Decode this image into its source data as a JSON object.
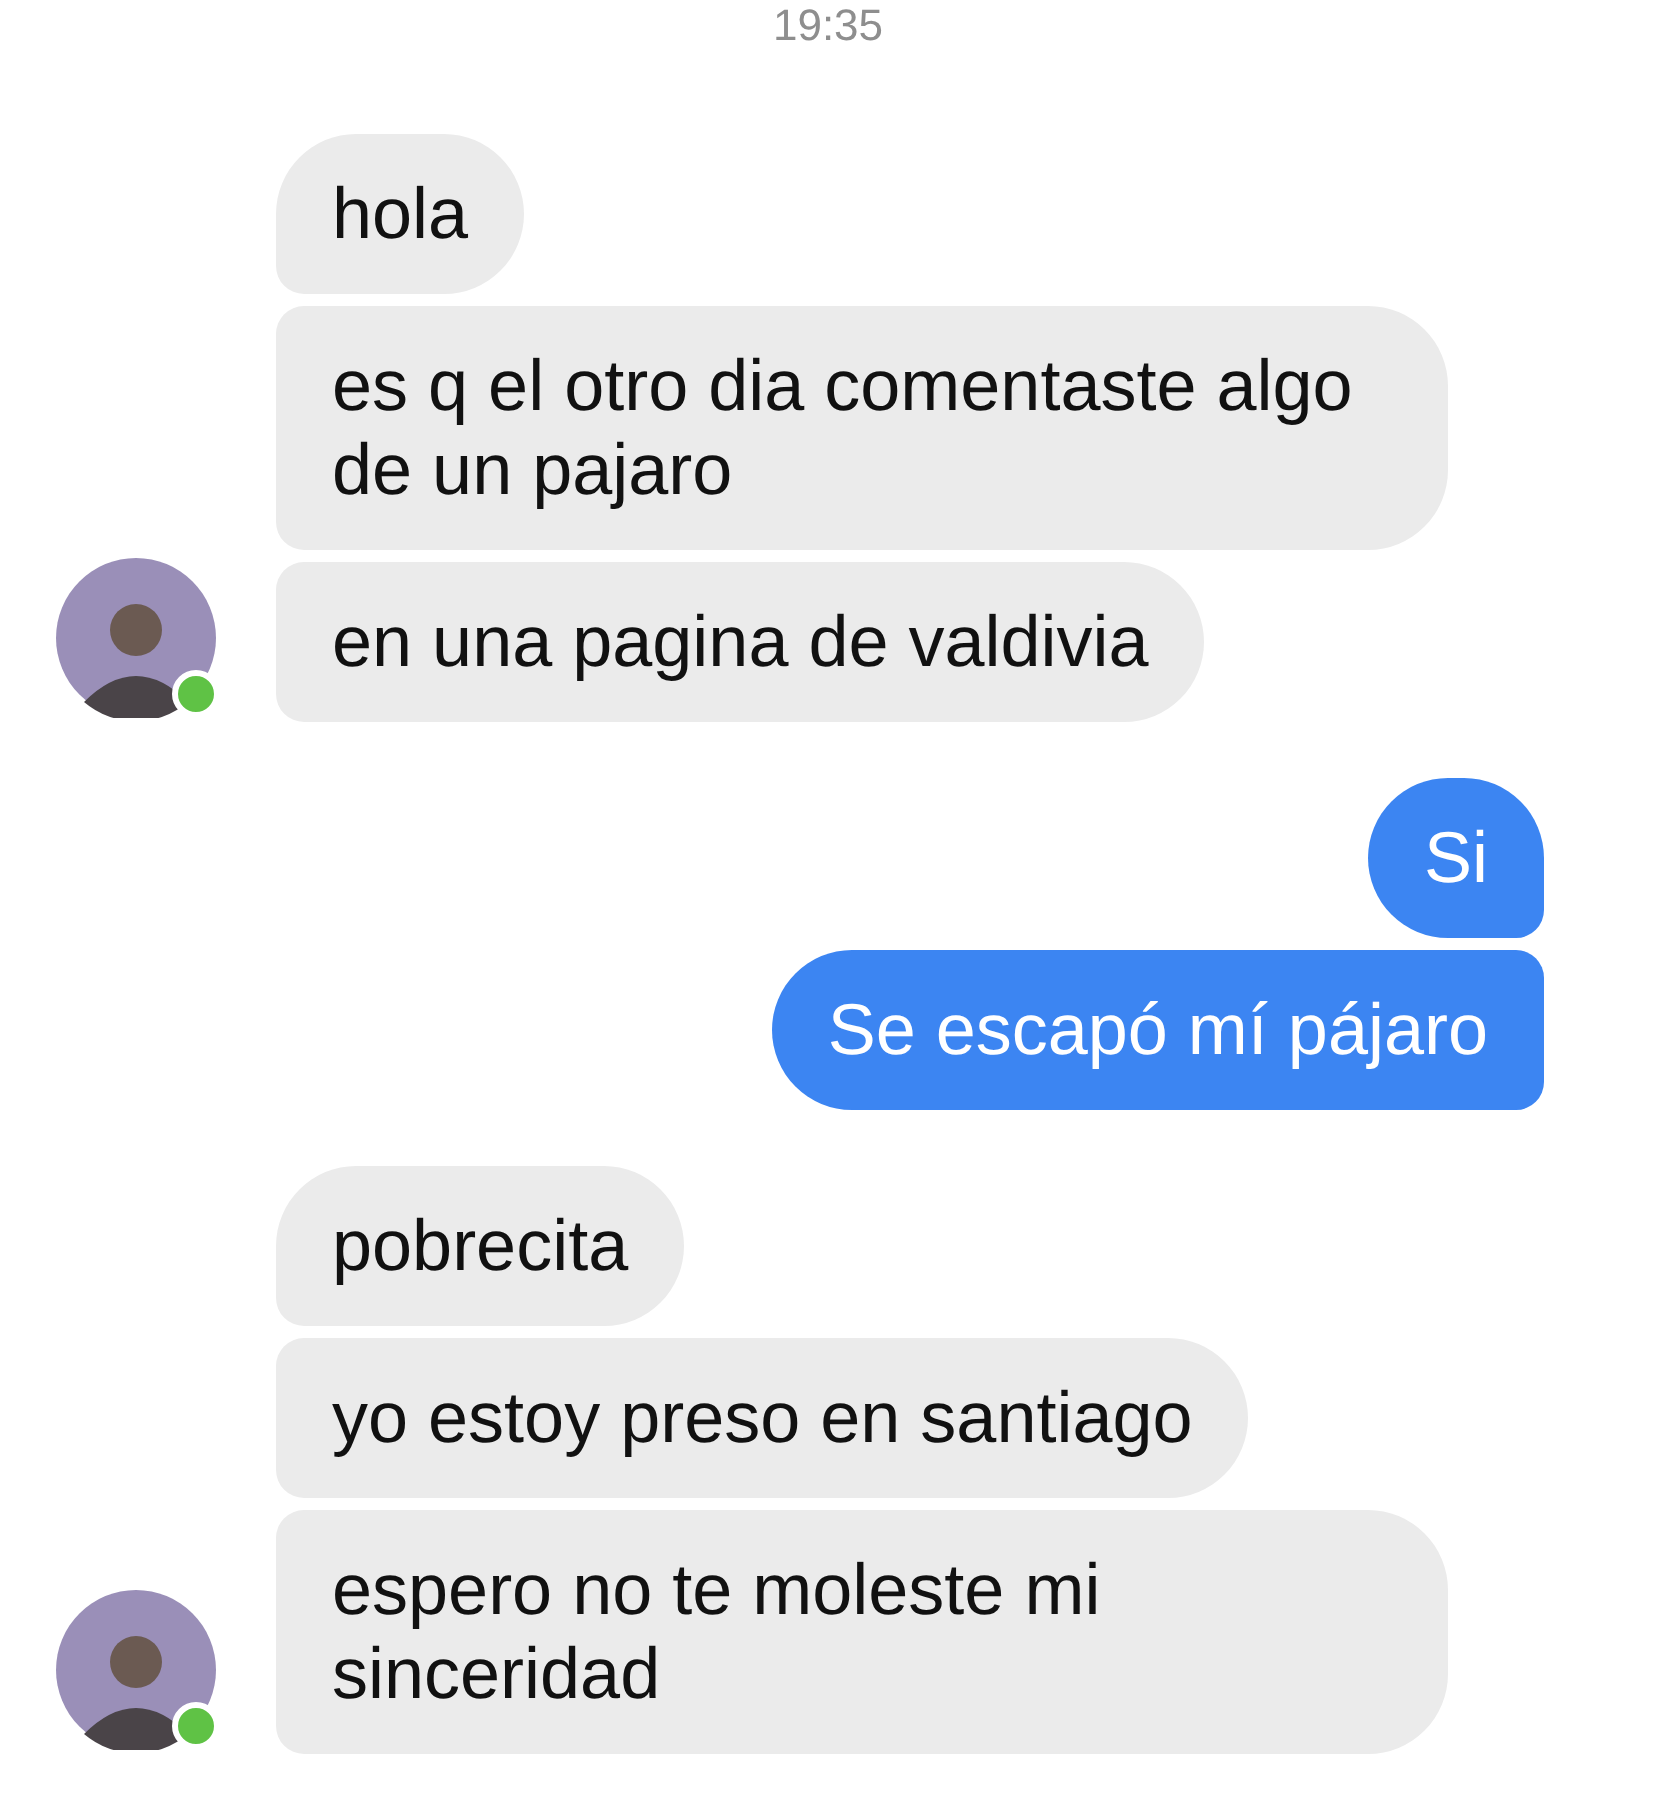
{
  "time": "19:35",
  "groups": [
    {
      "kind": "received",
      "online": true,
      "messages": [
        "hola",
        "es q el otro dia comentaste algo de un pajaro",
        "en una pagina de valdivia"
      ]
    },
    {
      "kind": "sent",
      "messages": [
        "Si",
        "Se escapó mí pájaro"
      ]
    },
    {
      "kind": "received",
      "online": true,
      "messages": [
        "pobrecita",
        "yo estoy preso en santiago",
        "espero no te moleste mi sinceridad"
      ]
    }
  ]
}
